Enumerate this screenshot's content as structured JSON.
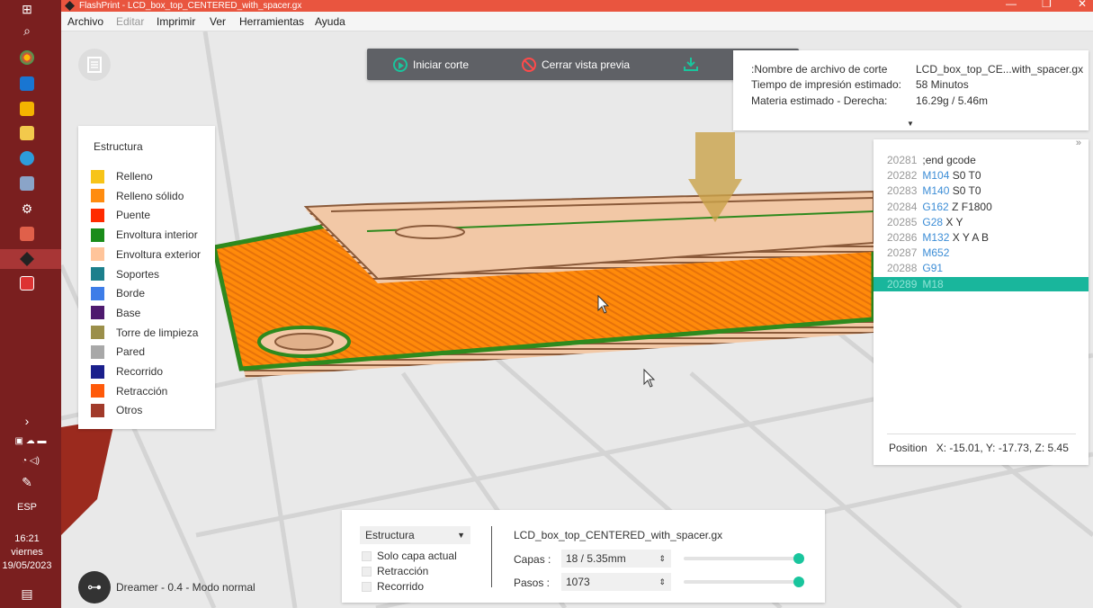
{
  "title_bar": {
    "title": "FlashPrint - LCD_box_top_CENTERED_with_spacer.gx"
  },
  "menu": [
    "Archivo",
    "Editar",
    "Imprimir",
    "Ver",
    "Herramientas",
    "Ayuda"
  ],
  "toolbar": {
    "start_slice": "Iniciar corte",
    "close_preview": "Cerrar vista previa"
  },
  "info": {
    "file_label": "Nombre de archivo de corte:",
    "file_value": "LCD_box_top_CE...with_spacer.gx",
    "time_label": "Tiempo de impresión estimado:",
    "time_value": "58 Minutos",
    "material_label": "Materia estimado - Derecha:",
    "material_value": "16.29g / 5.46m"
  },
  "legend": {
    "title": "Estructura",
    "items": [
      {
        "label": "Relleno",
        "color": "#f7c418"
      },
      {
        "label": "Relleno sólido",
        "color": "#ff8c10"
      },
      {
        "label": "Puente",
        "color": "#ff2b00"
      },
      {
        "label": "Envoltura interior",
        "color": "#1a8c1a"
      },
      {
        "label": "Envoltura exterior",
        "color": "#ffc49a"
      },
      {
        "label": "Soportes",
        "color": "#1c7f8c"
      },
      {
        "label": "Borde",
        "color": "#3d7de8"
      },
      {
        "label": "Base",
        "color": "#4e1a6e"
      },
      {
        "label": "Torre de limpieza",
        "color": "#9b8f4a"
      },
      {
        "label": "Pared",
        "color": "#a8a8a8"
      },
      {
        "label": "Recorrido",
        "color": "#1a1f8c"
      },
      {
        "label": "Retracción",
        "color": "#ff5a0a"
      },
      {
        "label": "Otros",
        "color": "#a13a2a"
      }
    ]
  },
  "gcode": {
    "lines": [
      {
        "n": "20281",
        "cmd": "",
        "rest": ";end gcode"
      },
      {
        "n": "20282",
        "cmd": "M104",
        "rest": " S0 T0"
      },
      {
        "n": "20283",
        "cmd": "M140",
        "rest": " S0 T0"
      },
      {
        "n": "20284",
        "cmd": "G162",
        "rest": " Z F1800"
      },
      {
        "n": "20285",
        "cmd": "G28",
        "rest": " X Y"
      },
      {
        "n": "20286",
        "cmd": "M132",
        "rest": " X Y A B"
      },
      {
        "n": "20287",
        "cmd": "M652",
        "rest": ""
      },
      {
        "n": "20288",
        "cmd": "G91",
        "rest": ""
      },
      {
        "n": "20289",
        "cmd": "M18",
        "rest": ""
      }
    ],
    "position": "Position   X: -15.01, Y: -17.73, Z: 5.45"
  },
  "bottom": {
    "view_select": "Estructura",
    "chk_layer": "Solo capa actual",
    "chk_retract": "Retracción",
    "chk_travel": "Recorrido",
    "filename": "LCD_box_top_CENTERED_with_spacer.gx",
    "layers_label": "Capas :",
    "layers_value": "18 / 5.35mm",
    "steps_label": "Pasos :",
    "steps_value": "1073"
  },
  "printer": {
    "label": "Dreamer - 0.4 - Modo normal"
  },
  "taskbar": {
    "time": "16:21",
    "day": "viernes",
    "date": "19/05/2023",
    "lang": "ESP"
  }
}
